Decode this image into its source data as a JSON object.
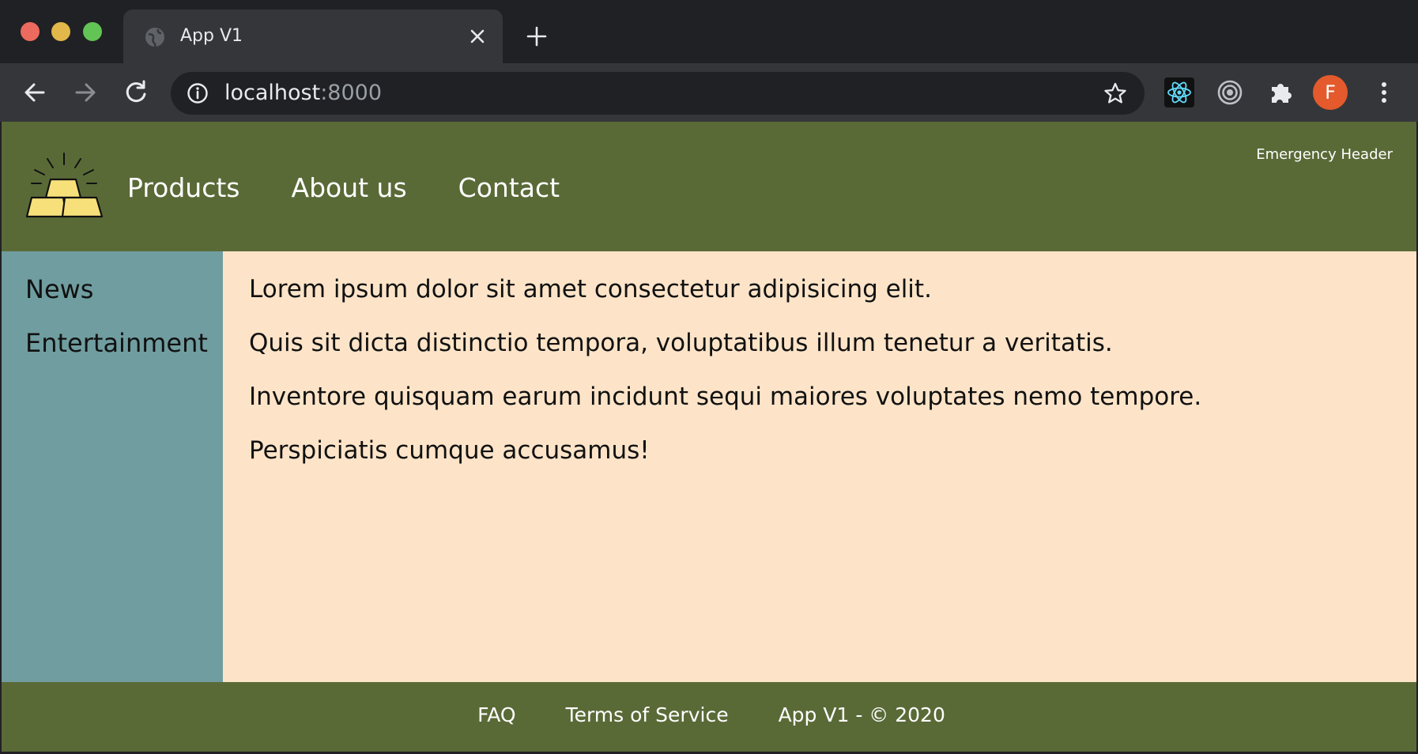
{
  "browser": {
    "tab_title": "App V1",
    "url_host": "localhost",
    "url_port": ":8000",
    "avatar_letter": "F",
    "icons": [
      "globe-icon",
      "close-icon",
      "plus-icon",
      "back-arrow-icon",
      "forward-arrow-icon",
      "reload-icon",
      "info-icon",
      "star-icon",
      "react-devtools-icon",
      "target-icon",
      "puzzle-icon",
      "more-vert-icon"
    ]
  },
  "header": {
    "logo_icon": "gold-bars-icon",
    "nav": [
      "Products",
      "About us",
      "Contact"
    ],
    "emergency": "Emergency Header"
  },
  "sidebar": {
    "items": [
      "News",
      "Entertainment"
    ]
  },
  "content": {
    "paragraphs": [
      "Lorem ipsum dolor sit amet consectetur adipisicing elit.",
      "Quis sit dicta distinctio tempora, voluptatibus illum tenetur a veritatis.",
      "Inventore quisquam earum incidunt sequi maiores voluptates nemo tempore.",
      "Perspiciatis cumque accusamus!"
    ]
  },
  "footer": {
    "faq": "FAQ",
    "terms": "Terms of Service",
    "copyright": "App V1 - © 2020"
  },
  "colors": {
    "header_bg": "#5a6a37",
    "sidebar_bg": "#709da0",
    "content_bg": "#fde4c8",
    "avatar_bg": "#e45a2c"
  }
}
